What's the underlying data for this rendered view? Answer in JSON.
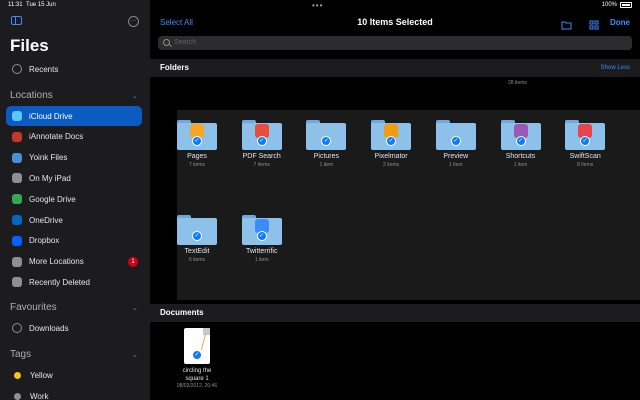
{
  "status": {
    "time": "11:31",
    "date": "Tue 15 Jun",
    "battery": "100%"
  },
  "sidebar": {
    "title": "Files",
    "recents": "Recents",
    "locations_header": "Locations",
    "locations": [
      {
        "label": "iCloud Drive",
        "icon": "cloud-icon",
        "color": "#5ac8fa",
        "selected": true
      },
      {
        "label": "iAnnotate Docs",
        "icon": "iannotate-icon",
        "color": "#c0392b"
      },
      {
        "label": "Yoink Files",
        "icon": "yoink-icon",
        "color": "#4a90d9"
      },
      {
        "label": "On My iPad",
        "icon": "ipad-icon",
        "color": "#8e8e93"
      },
      {
        "label": "Google Drive",
        "icon": "google-drive-icon",
        "color": "#34a853"
      },
      {
        "label": "OneDrive",
        "icon": "onedrive-icon",
        "color": "#0a64c2"
      },
      {
        "label": "Dropbox",
        "icon": "dropbox-icon",
        "color": "#0061fe"
      },
      {
        "label": "More Locations",
        "icon": "more-icon",
        "color": "#8e8e93",
        "badge": "1"
      },
      {
        "label": "Recently Deleted",
        "icon": "trash-icon",
        "color": "#8e8e93"
      }
    ],
    "favourites_header": "Favourites",
    "favourites": [
      {
        "label": "Downloads",
        "icon": "download-icon"
      }
    ],
    "tags_header": "Tags",
    "tags": [
      {
        "label": "Yellow",
        "color": "#f5c518"
      },
      {
        "label": "Work",
        "color": "#8e8e93"
      }
    ]
  },
  "toolbar": {
    "select_all": "Select All",
    "title": "10 Items Selected",
    "done": "Done",
    "search_placeholder": "Search"
  },
  "folders_section": {
    "title": "Folders",
    "show_less": "Show Less",
    "count": "28 items"
  },
  "folders": [
    {
      "name": "Pages",
      "count": "7 items",
      "app_color": "#f5a623"
    },
    {
      "name": "PDF Search",
      "count": "7 items",
      "app_color": "#e74c3c"
    },
    {
      "name": "Pictures",
      "count": "1 item",
      "app_color": ""
    },
    {
      "name": "Pixelmator",
      "count": "2 items",
      "app_color": "#f39c12"
    },
    {
      "name": "Preview",
      "count": "1 item",
      "app_color": ""
    },
    {
      "name": "Shortcuts",
      "count": "1 item",
      "app_color": "#9b59b6"
    },
    {
      "name": "SwiftScan",
      "count": "8 items",
      "app_color": "#e8434f"
    },
    {
      "name": "TextEdit",
      "count": "6 items",
      "app_color": ""
    },
    {
      "name": "Twitterrific",
      "count": "1 item",
      "app_color": "#3d8bfd"
    }
  ],
  "documents_section": {
    "title": "Documents"
  },
  "documents": [
    {
      "name_line1": "circling the",
      "name_line2": "square 1",
      "date": "08/03/2012, 20:46"
    }
  ]
}
